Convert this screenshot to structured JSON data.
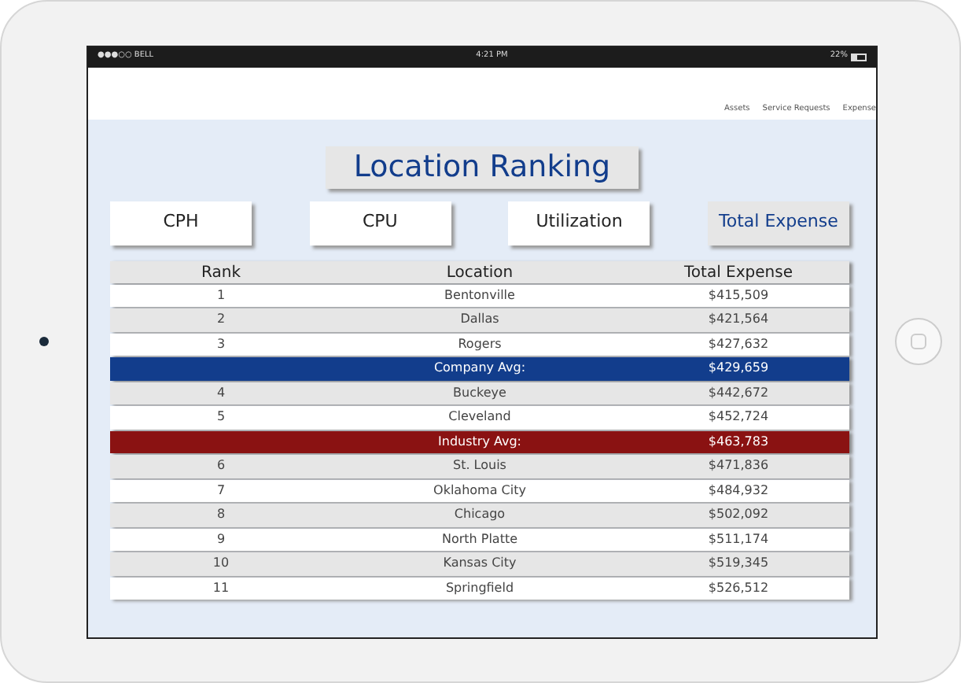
{
  "status_bar": {
    "carrier": "●●●○○ BELL",
    "time": "4:21 PM",
    "battery": "22%"
  },
  "nav": [
    "Assets",
    "Service Requests",
    "Expense"
  ],
  "title": "Location Ranking",
  "tabs": [
    {
      "label": "CPH",
      "selected": false
    },
    {
      "label": "CPU",
      "selected": false
    },
    {
      "label": "Utilization",
      "selected": false
    },
    {
      "label": "Total Expense",
      "selected": true
    }
  ],
  "table": {
    "columns": [
      "Rank",
      "Location",
      "Total Expense"
    ],
    "rows": [
      {
        "kind": "location",
        "rank": "1",
        "location": "Bentonville",
        "value": "$415,509"
      },
      {
        "kind": "location",
        "rank": "2",
        "location": "Dallas",
        "value": "$421,564"
      },
      {
        "kind": "location",
        "rank": "3",
        "location": "Rogers",
        "value": "$427,632"
      },
      {
        "kind": "average",
        "label": "Company Avg:",
        "value": "$429,659",
        "color": "#123d8c"
      },
      {
        "kind": "location",
        "rank": "4",
        "location": "Buckeye",
        "value": "$442,672"
      },
      {
        "kind": "location",
        "rank": "5",
        "location": "Cleveland",
        "value": "$452,724"
      },
      {
        "kind": "average",
        "label": "Industry Avg:",
        "value": "$463,783",
        "color": "#8a1212"
      },
      {
        "kind": "location",
        "rank": "6",
        "location": "St. Louis",
        "value": "$471,836"
      },
      {
        "kind": "location",
        "rank": "7",
        "location": "Oklahoma City",
        "value": "$484,932"
      },
      {
        "kind": "location",
        "rank": "8",
        "location": "Chicago",
        "value": "$502,092"
      },
      {
        "kind": "location",
        "rank": "9",
        "location": "North Platte",
        "value": "$511,174"
      },
      {
        "kind": "location",
        "rank": "10",
        "location": "Kansas City",
        "value": "$519,345"
      },
      {
        "kind": "location",
        "rank": "11",
        "location": "Springfield",
        "value": "$526,512"
      }
    ]
  }
}
